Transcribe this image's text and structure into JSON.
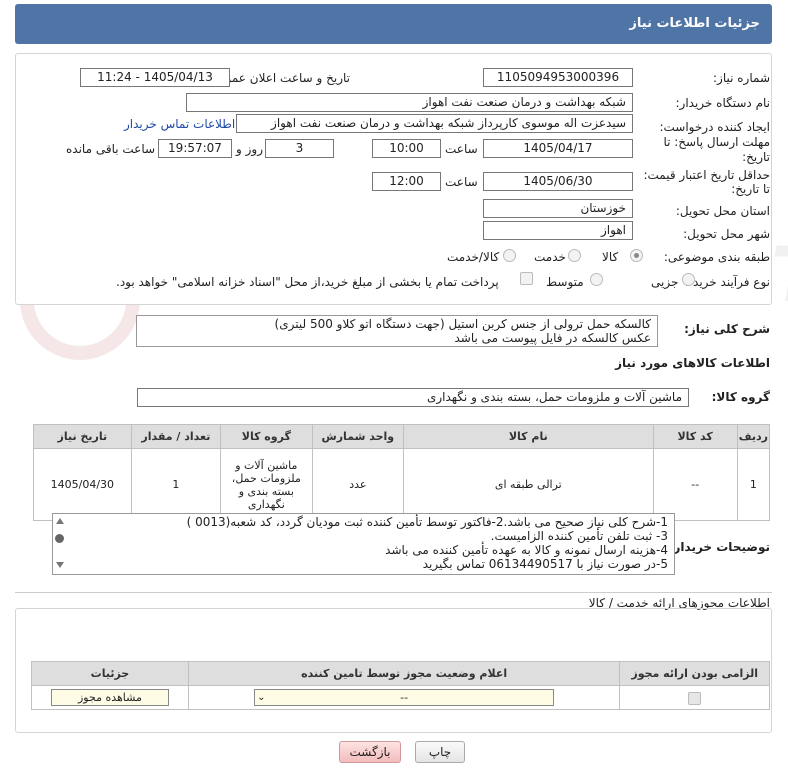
{
  "header": {
    "title": "جزئیات اطلاعات نیاز"
  },
  "form": {
    "need_number_label": "شماره نیاز:",
    "need_number": "1105094953000396",
    "announce_label": "تاریخ و ساعت اعلان عمومی:",
    "announce_value": "1405/04/13 - 11:24",
    "buyer_org_label": "نام دستگاه خریدار:",
    "buyer_org": "شبکه بهداشت و درمان صنعت نفت اهواز",
    "creator_label": "ایجاد کننده درخواست:",
    "creator": "سیدعزت اله موسوی کارپرداز شبکه بهداشت و درمان صنعت نفت اهواز",
    "buyer_contact_link": "اطلاعات تماس خریدار",
    "deadline_label_1": "مهلت ارسال پاسخ: تا",
    "deadline_label_2": "تاریخ:",
    "deadline_date": "1405/04/17",
    "hour_label": "ساعت",
    "deadline_time": "10:00",
    "days_count": "3",
    "days_label": "روز و",
    "remaining_time": "19:57:07",
    "remaining_label": "ساعت باقی مانده",
    "min_price_label_1": "حداقل تاریخ اعتبار قیمت:",
    "min_price_label_2": "تا تاریخ:",
    "min_price_date": "1405/06/30",
    "min_price_hour_label": "ساعت",
    "min_price_time": "12:00",
    "province_label": "استان محل تحویل:",
    "province": "خوزستان",
    "city_label": "شهر محل تحویل:",
    "city": "اهواز",
    "category_label": "طبقه بندی موضوعی:",
    "category_options": [
      "کالا",
      "خدمت",
      "کالا/خدمت"
    ],
    "category_selected": "کالا",
    "process_label": "نوع فرآیند خرید :",
    "process_options": [
      "جزیی",
      "متوسط"
    ],
    "process_note": "پرداخت تمام یا بخشی از مبلغ خرید،از محل \"اسناد خزانه اسلامی\" خواهد بود."
  },
  "general_desc": {
    "label": "شرح کلی نیاز:",
    "lines": [
      "کالسکه حمل ترولی از جنس کربن استیل (جهت دستگاه اتو کلاو 500 لیتری)",
      "عکس کالسکه در فایل پیوست می باشد"
    ]
  },
  "goods_info_title": "اطلاعات کالاهای مورد نیاز",
  "goods_group": {
    "label": "گروه کالا:",
    "value": "ماشین آلات و ملزومات حمل، بسته بندی و نگهداری"
  },
  "goods_table": {
    "headers": [
      "ردیف",
      "کد کالا",
      "نام کالا",
      "واحد شمارش",
      "گروه کالا",
      "تعداد / مقدار",
      "تاریخ نیاز"
    ],
    "rows": [
      {
        "row": "1",
        "code": "--",
        "name": "ترالی طبقه ای",
        "unit": "عدد",
        "group": "ماشین آلات و ملزومات حمل، بسته بندی و نگهداری",
        "qty": "1",
        "date": "1405/04/30"
      }
    ]
  },
  "buyer_notes": {
    "label": "توضیحات خریدار:",
    "lines": [
      "1-شرح کلی نیاز صحیح می باشد.2-فاکتور توسط تأمین کننده ثبت مودیان گردد، کد شعبه(0013 )",
      " 3- ثبت تلفن تأمین کننده الزامیست.",
      "4-هزینه ارسال نمونه و کالا به عهده تأمین کننده می باشد",
      "5-در صورت نیاز با 06134490517 تماس بگیرید"
    ]
  },
  "permits": {
    "title": "اطلاعات مجوزهای ارائه خدمت / کالا",
    "headers": [
      "الزامی بودن ارائه مجوز",
      "اعلام وضعیت مجوز توسط تامین کننده",
      "جزئیات"
    ],
    "select_value": "--",
    "view_button": "مشاهده مجوز"
  },
  "buttons": {
    "print": "چاپ",
    "back": "بازگشت"
  },
  "watermark": "AriaTender.neT"
}
